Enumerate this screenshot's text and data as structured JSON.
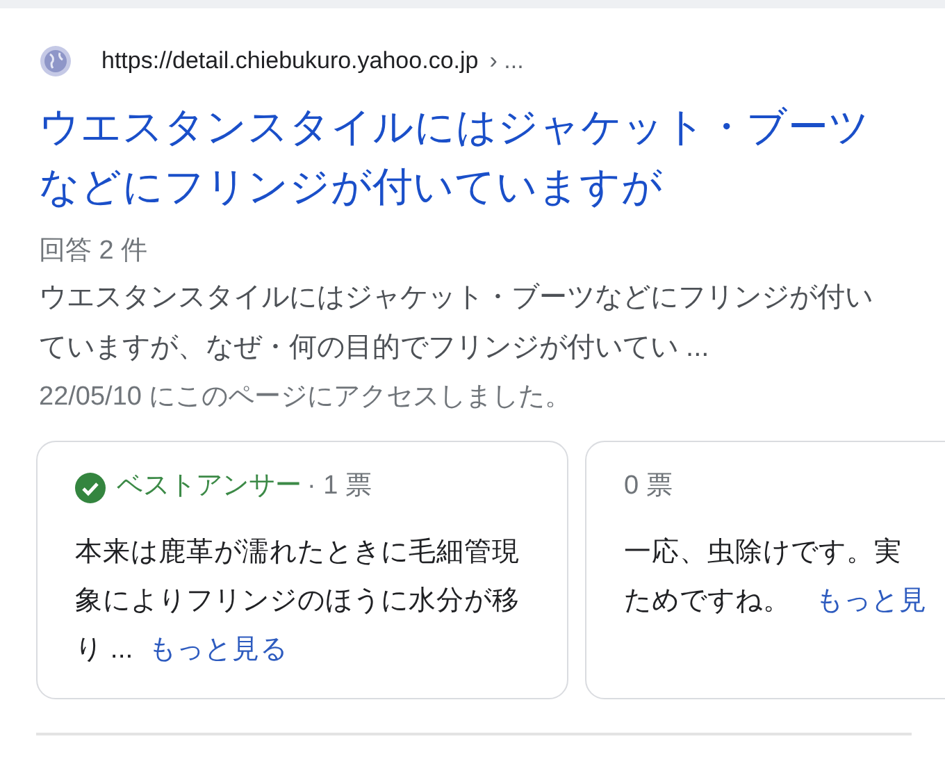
{
  "result": {
    "url": "https://detail.chiebukuro.yahoo.co.jp",
    "breadcrumb": "› ...",
    "title": "ウエスタンスタイルにはジャケット・ブーツなどにフリンジが付いていますが",
    "answer_count": "回答 2 件",
    "snippet": "ウエスタンスタイルにはジャケット・ブーツなどにフリンジが付いていますが、なぜ・何の目的でフリンジが付いてい ...",
    "visited": "22/05/10 にこのページにアクセスしました。"
  },
  "answers": [
    {
      "best": true,
      "best_label": "ベストアンサー",
      "separator": "·",
      "votes": "1 票",
      "text": "本来は鹿革が濡れたときに毛細管現象によりフリンジのほうに水分が移り ...",
      "more": "もっと見る"
    },
    {
      "best": false,
      "votes": "0 票",
      "text_lines": [
        "一応、虫除けです。実",
        "ためですね。"
      ],
      "more": "もっと見"
    }
  ]
}
